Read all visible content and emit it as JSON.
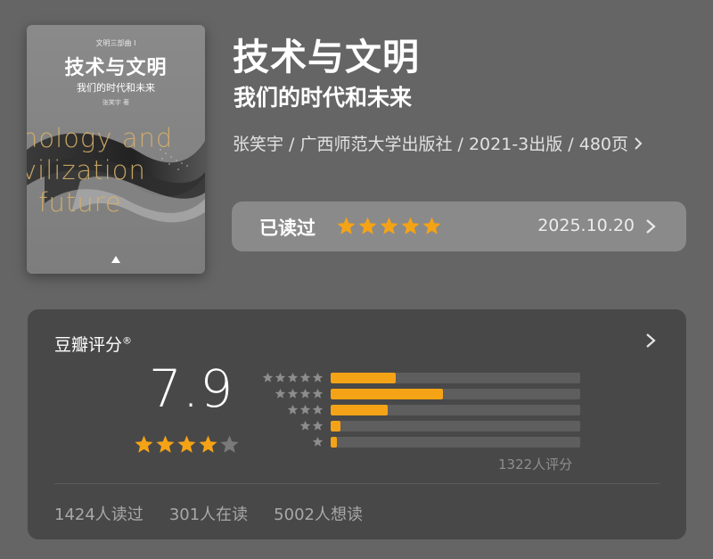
{
  "cover": {
    "series": "文明三部曲 Ⅰ",
    "title": "技术与文明",
    "subtitle": "我们的时代和未来",
    "author": "张笑宇 著",
    "en_lines": [
      "nology and",
      "vilization",
      "l future"
    ]
  },
  "book": {
    "title": "技术与文明",
    "subtitle": "我们的时代和未来",
    "meta": "张笑宇 / 广西师范大学出版社 / 2021-3出版 / 480页"
  },
  "read_status": {
    "label": "已读过",
    "stars": 5,
    "date": "2025.10.20"
  },
  "rating": {
    "heading": "豆瓣评分",
    "registered": "®",
    "score": "7.9",
    "stars": 4,
    "distribution": [
      {
        "stars": 5,
        "fraction": 0.26
      },
      {
        "stars": 4,
        "fraction": 0.45
      },
      {
        "stars": 3,
        "fraction": 0.23
      },
      {
        "stars": 2,
        "fraction": 0.04
      },
      {
        "stars": 1,
        "fraction": 0.025
      }
    ],
    "count_text": "1322人评分",
    "stats": [
      "1424人读过",
      "301人在读",
      "5002人想读"
    ]
  },
  "colors": {
    "accent_star": "#f5a316",
    "empty_star": "#8d8d8d",
    "background": "#656565",
    "card": "#484848"
  }
}
